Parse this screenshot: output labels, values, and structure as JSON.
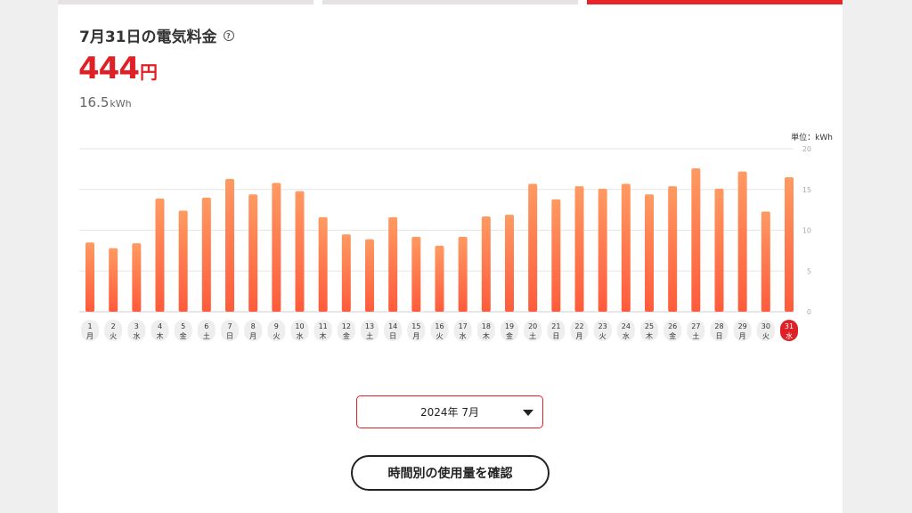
{
  "header": {
    "title": "7月31日の電気料金",
    "help_glyph": "?",
    "cost_value": "444",
    "cost_unit": "円",
    "usage_value": "16.5",
    "usage_unit": "kWh"
  },
  "chart_data": {
    "type": "bar",
    "unit_label": "単位：kWh",
    "ylim": [
      0,
      20
    ],
    "yticks": [
      0,
      5,
      10,
      15,
      20
    ],
    "grid": true,
    "categories": [
      "1",
      "2",
      "3",
      "4",
      "5",
      "6",
      "7",
      "8",
      "9",
      "10",
      "11",
      "12",
      "13",
      "14",
      "15",
      "16",
      "17",
      "18",
      "19",
      "20",
      "21",
      "22",
      "23",
      "24",
      "25",
      "26",
      "27",
      "28",
      "29",
      "30",
      "31"
    ],
    "weekdays": [
      "月",
      "火",
      "水",
      "木",
      "金",
      "土",
      "日",
      "月",
      "火",
      "水",
      "木",
      "金",
      "土",
      "日",
      "月",
      "火",
      "水",
      "木",
      "金",
      "土",
      "日",
      "月",
      "火",
      "水",
      "木",
      "金",
      "土",
      "日",
      "月",
      "火",
      "水"
    ],
    "values": [
      8.5,
      7.8,
      8.4,
      13.9,
      12.4,
      14.0,
      16.3,
      14.4,
      15.8,
      14.8,
      11.6,
      9.5,
      8.9,
      11.6,
      9.2,
      8.1,
      9.2,
      11.7,
      11.9,
      15.7,
      13.8,
      15.4,
      15.1,
      15.7,
      14.4,
      15.4,
      17.6,
      15.1,
      17.2,
      12.3,
      16.5
    ],
    "highlight_index": 30,
    "colors": {
      "bar_top": "#ff9a62",
      "bar_bottom": "#ff5b3b",
      "highlight": "#e02027",
      "grid": "#e6e6e6"
    }
  },
  "month_select": {
    "value": "2024年 7月"
  },
  "hourly_button": {
    "label": "時間別の使用量を確認"
  },
  "colors": {
    "accent": "#e02027",
    "tab_inactive": "#e7e1e1",
    "tab_active": "#e8242a"
  }
}
